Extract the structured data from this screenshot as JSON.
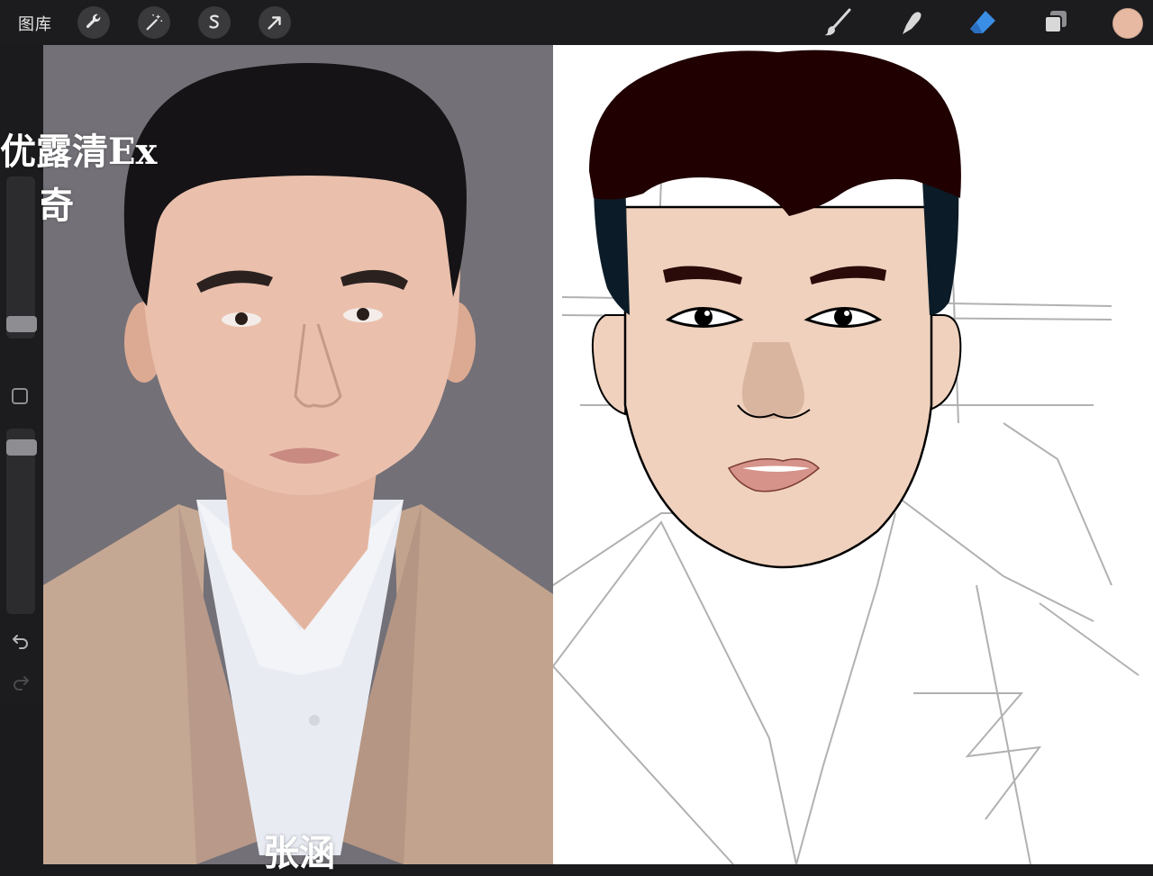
{
  "toolbar": {
    "gallery_label": "图库",
    "left_tools": [
      "wrench-icon",
      "magic-wand-icon",
      "selection-icon",
      "transform-arrow-icon"
    ],
    "right_tools": [
      "brush-icon",
      "smudge-icon",
      "eraser-icon",
      "layers-icon"
    ],
    "active_tool": "eraser-icon",
    "active_tool_color": "#3a8ee6",
    "current_color": "#e7b9a3"
  },
  "sidebar": {
    "brush_size_level": 0.2,
    "opacity_level": 0.95
  },
  "watermark": {
    "line1": "优露清Ex",
    "line2": "奇",
    "name": "张涵"
  }
}
